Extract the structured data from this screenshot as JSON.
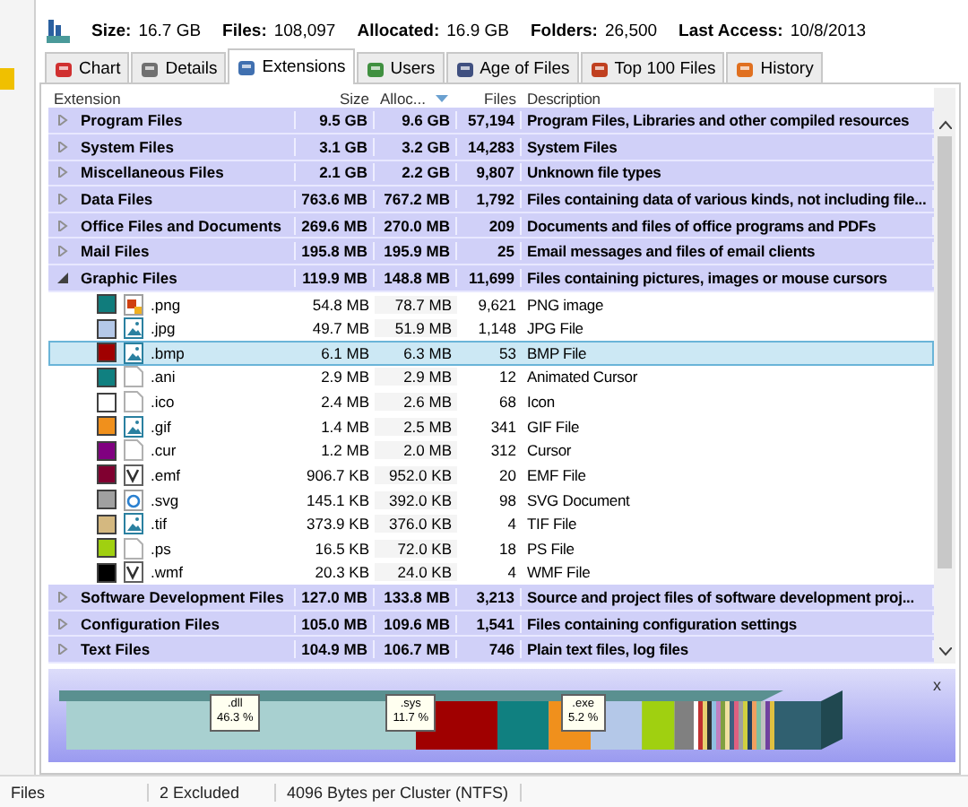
{
  "info": [
    {
      "label": "Size:",
      "value": "16.7 GB"
    },
    {
      "label": "Files:",
      "value": "108,097"
    },
    {
      "label": "Allocated:",
      "value": "16.9 GB"
    },
    {
      "label": "Folders:",
      "value": "26,500"
    },
    {
      "label": "Last Access:",
      "value": "10/8/2013"
    }
  ],
  "tabs": [
    {
      "label": "Chart",
      "kind": "chart",
      "selected": false
    },
    {
      "label": "Details",
      "kind": "details",
      "selected": false
    },
    {
      "label": "Extensions",
      "kind": "extensions",
      "selected": true
    },
    {
      "label": "Users",
      "kind": "users",
      "selected": false
    },
    {
      "label": "Age of Files",
      "kind": "calendar",
      "selected": false
    },
    {
      "label": "Top 100 Files",
      "kind": "top",
      "selected": false
    },
    {
      "label": "History",
      "kind": "history",
      "selected": false
    }
  ],
  "table": {
    "columns": [
      {
        "label": "Extension",
        "sorted": false
      },
      {
        "label": "Size",
        "sorted": false
      },
      {
        "label": "Alloc...",
        "sorted": true
      },
      {
        "label": "Files",
        "sorted": false
      },
      {
        "label": "Description",
        "sorted": false
      }
    ],
    "rows": [
      {
        "name": "Program Files",
        "size": "9.5 GB",
        "alloc": "9.6 GB",
        "files": "57,194",
        "description": "Program Files, Libraries and other compiled resources",
        "expanded": false,
        "selected": false
      },
      {
        "name": "System Files",
        "size": "3.1 GB",
        "alloc": "3.2 GB",
        "files": "14,283",
        "description": "System Files",
        "expanded": false,
        "selected": false
      },
      {
        "name": "Miscellaneous Files",
        "size": "2.1 GB",
        "alloc": "2.2 GB",
        "files": "9,807",
        "description": "Unknown file types",
        "expanded": false,
        "selected": false
      },
      {
        "name": "Data Files",
        "size": "763.6 MB",
        "alloc": "767.2 MB",
        "files": "1,792",
        "description": "Files containing data of various kinds, not including file...",
        "expanded": false,
        "selected": false
      },
      {
        "name": "Office Files and Documents",
        "size": "269.6 MB",
        "alloc": "270.0 MB",
        "files": "209",
        "description": "Documents and files of office programs and PDFs",
        "expanded": false,
        "selected": false
      },
      {
        "name": "Mail Files",
        "size": "195.8 MB",
        "alloc": "195.9 MB",
        "files": "25",
        "description": "Email messages and files of email clients",
        "expanded": false,
        "selected": false
      },
      {
        "name": "Graphic Files",
        "size": "119.9 MB",
        "alloc": "148.8 MB",
        "files": "11,699",
        "description": "Files containing pictures, images or mouse cursors",
        "expanded": true,
        "selected": false,
        "children": [
          {
            "name": ".png",
            "kind": "png",
            "color": "#107c7c",
            "size": "54.8 MB",
            "alloc": "78.7 MB",
            "files": "9,621",
            "description": "PNG image",
            "selected": false
          },
          {
            "name": ".jpg",
            "kind": "image",
            "color": "#b4c8e8",
            "size": "49.7 MB",
            "alloc": "51.9 MB",
            "files": "1,148",
            "description": "JPG File",
            "selected": false
          },
          {
            "name": ".bmp",
            "kind": "image",
            "color": "#a00000",
            "size": "6.1 MB",
            "alloc": "6.3 MB",
            "files": "53",
            "description": "BMP File",
            "selected": true
          },
          {
            "name": ".ani",
            "kind": "blank",
            "color": "#108080",
            "size": "2.9 MB",
            "alloc": "2.9 MB",
            "files": "12",
            "description": "Animated Cursor",
            "selected": false
          },
          {
            "name": ".ico",
            "kind": "blank",
            "color": "#ffffff",
            "size": "2.4 MB",
            "alloc": "2.6 MB",
            "files": "68",
            "description": "Icon",
            "selected": false
          },
          {
            "name": ".gif",
            "kind": "image",
            "color": "#f0901c",
            "size": "1.4 MB",
            "alloc": "2.5 MB",
            "files": "341",
            "description": "GIF File",
            "selected": false
          },
          {
            "name": ".cur",
            "kind": "blank",
            "color": "#800080",
            "size": "1.2 MB",
            "alloc": "2.0 MB",
            "files": "312",
            "description": "Cursor",
            "selected": false
          },
          {
            "name": ".emf",
            "kind": "metafile",
            "color": "#800030",
            "size": "906.7 KB",
            "alloc": "952.0 KB",
            "files": "20",
            "description": "EMF File",
            "selected": false
          },
          {
            "name": ".svg",
            "kind": "web",
            "color": "#a0a0a0",
            "size": "145.1 KB",
            "alloc": "392.0 KB",
            "files": "98",
            "description": "SVG Document",
            "selected": false
          },
          {
            "name": ".tif",
            "kind": "image",
            "color": "#d4b880",
            "size": "373.9 KB",
            "alloc": "376.0 KB",
            "files": "4",
            "description": "TIF File",
            "selected": false
          },
          {
            "name": ".ps",
            "kind": "blank",
            "color": "#a0d010",
            "size": "16.5 KB",
            "alloc": "72.0 KB",
            "files": "18",
            "description": "PS File",
            "selected": false
          },
          {
            "name": ".wmf",
            "kind": "metafile",
            "color": "#000000",
            "size": "20.3 KB",
            "alloc": "24.0 KB",
            "files": "4",
            "description": "WMF File",
            "selected": false
          }
        ]
      },
      {
        "name": "Software Development Files",
        "size": "127.0 MB",
        "alloc": "133.8 MB",
        "files": "3,213",
        "description": "Source and project files of software development proj...",
        "expanded": false,
        "selected": false
      },
      {
        "name": "Configuration Files",
        "size": "105.0 MB",
        "alloc": "109.6 MB",
        "files": "1,541",
        "description": "Files containing configuration settings",
        "expanded": false,
        "selected": false
      },
      {
        "name": "Text Files",
        "size": "104.9 MB",
        "alloc": "106.7 MB",
        "files": "746",
        "description": "Plain text files, log files",
        "expanded": false,
        "selected": false
      }
    ]
  },
  "share_bar": {
    "close": "x",
    "labels": [
      {
        "name": ".dll",
        "share": "46.3 %"
      },
      {
        "name": ".sys",
        "share": "11.7 %"
      },
      {
        "name": ".exe",
        "share": "5.2 %"
      }
    ]
  },
  "status_bar": [
    "Files",
    "2 Excluded",
    "4096 Bytes per Cluster (NTFS)"
  ]
}
